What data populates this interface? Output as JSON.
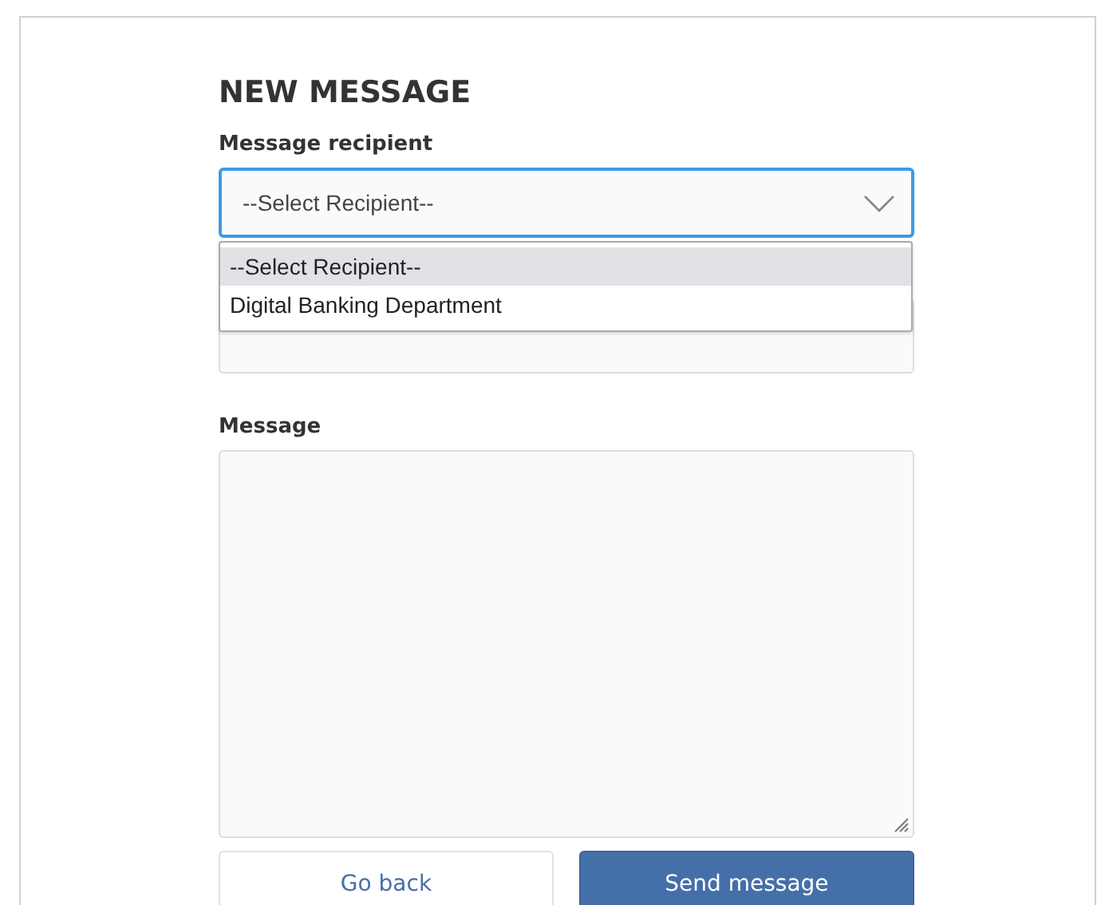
{
  "title": "NEW MESSAGE",
  "recipient": {
    "label": "Message recipient",
    "value": "--Select Recipient--",
    "expanded": true,
    "options": [
      {
        "label": "--Select Recipient--",
        "selected": true
      },
      {
        "label": "Digital Banking Department",
        "selected": false
      }
    ]
  },
  "message": {
    "label": "Message"
  },
  "buttons": [
    {
      "label": "Go back",
      "kind": "secondary"
    },
    {
      "label": "Send message",
      "kind": "primary"
    }
  ]
}
